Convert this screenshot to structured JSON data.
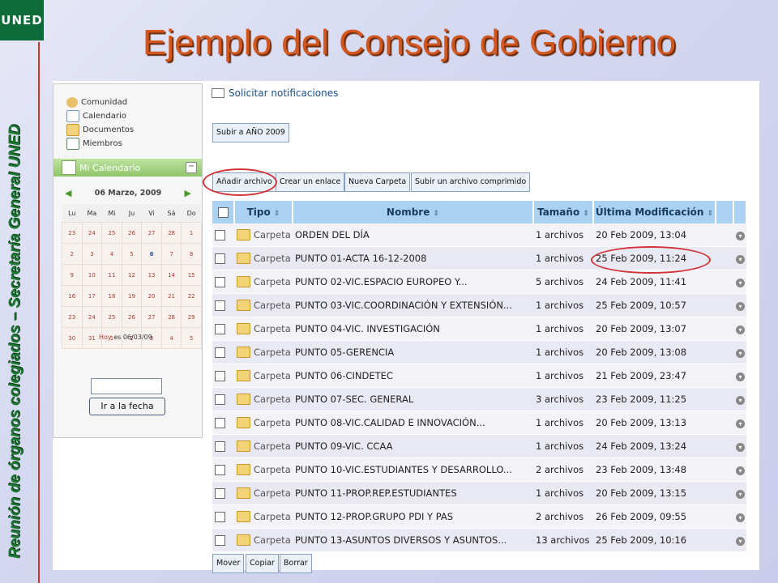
{
  "logo": "UNED",
  "side_caption": "Reunión de órganos colegiados – Secretaría General UNED",
  "title": "Ejemplo del Consejo de Gobierno",
  "sidebar": {
    "links": [
      {
        "label": "Comunidad",
        "icon": "community-icon"
      },
      {
        "label": "Calendario",
        "icon": "calendar-icon"
      },
      {
        "label": "Documentos",
        "icon": "documents-icon"
      },
      {
        "label": "Miembros",
        "icon": "members-icon"
      }
    ],
    "calendar": {
      "header": "Mi Calendario",
      "month": "06 Marzo, 2009",
      "days": [
        "Lu",
        "Ma",
        "Mi",
        "Ju",
        "Vi",
        "Sá",
        "Do"
      ],
      "weeks": [
        [
          "23",
          "24",
          "25",
          "26",
          "27",
          "28",
          "1"
        ],
        [
          "2",
          "3",
          "4",
          "5",
          "6",
          "7",
          "8"
        ],
        [
          "9",
          "10",
          "11",
          "12",
          "13",
          "14",
          "15"
        ],
        [
          "16",
          "17",
          "18",
          "19",
          "20",
          "21",
          "22"
        ],
        [
          "23",
          "24",
          "25",
          "26",
          "27",
          "28",
          "29"
        ],
        [
          "30",
          "31",
          "1",
          "2",
          "3",
          "4",
          "5"
        ]
      ],
      "today_link": "Hoy",
      "today_text": "es 06/03/09",
      "goto_label": "Ir a la fecha"
    }
  },
  "main": {
    "notify": "Solicitar notificaciones",
    "up_button": "Subir a AÑO 2009",
    "actions": [
      "Añadir archivo",
      "Crear un enlace",
      "Nueva Carpeta",
      "Subir un archivo comprimido"
    ],
    "columns": [
      "Tipo",
      "Nombre",
      "Tamaño",
      "Última Modificación"
    ],
    "rows": [
      {
        "tipo": "Carpeta",
        "nombre": "ORDEN DEL DÍA",
        "tamano": "1 archivos",
        "mod": "20 Feb 2009, 13:04"
      },
      {
        "tipo": "Carpeta",
        "nombre": "PUNTO 01-ACTA 16-12-2008",
        "tamano": "1 archivos",
        "mod": "25 Feb 2009, 11:24"
      },
      {
        "tipo": "Carpeta",
        "nombre": "PUNTO 02-VIC.ESPACIO EUROPEO Y...",
        "tamano": "5 archivos",
        "mod": "24 Feb 2009, 11:41"
      },
      {
        "tipo": "Carpeta",
        "nombre": "PUNTO 03-VIC.COORDINACIÓN Y EXTENSIÓN...",
        "tamano": "1 archivos",
        "mod": "25 Feb 2009, 10:57"
      },
      {
        "tipo": "Carpeta",
        "nombre": "PUNTO 04-VIC. INVESTIGACIÓN",
        "tamano": "1 archivos",
        "mod": "20 Feb 2009, 13:07"
      },
      {
        "tipo": "Carpeta",
        "nombre": "PUNTO 05-GERENCIA",
        "tamano": "1 archivos",
        "mod": "20 Feb 2009, 13:08"
      },
      {
        "tipo": "Carpeta",
        "nombre": "PUNTO 06-CINDETEC",
        "tamano": "1 archivos",
        "mod": "21 Feb 2009, 23:47"
      },
      {
        "tipo": "Carpeta",
        "nombre": "PUNTO 07-SEC. GENERAL",
        "tamano": "3 archivos",
        "mod": "23 Feb 2009, 11:25"
      },
      {
        "tipo": "Carpeta",
        "nombre": "PUNTO 08-VIC.CALIDAD E INNOVACIÓN...",
        "tamano": "1 archivos",
        "mod": "20 Feb 2009, 13:13"
      },
      {
        "tipo": "Carpeta",
        "nombre": "PUNTO 09-VIC. CCAA",
        "tamano": "1 archivos",
        "mod": "24 Feb 2009, 13:24"
      },
      {
        "tipo": "Carpeta",
        "nombre": "PUNTO 10-VIC.ESTUDIANTES Y DESARROLLO...",
        "tamano": "2 archivos",
        "mod": "23 Feb 2009, 13:48"
      },
      {
        "tipo": "Carpeta",
        "nombre": "PUNTO 11-PROP.REP.ESTUDIANTES",
        "tamano": "1 archivos",
        "mod": "20 Feb 2009, 13:15"
      },
      {
        "tipo": "Carpeta",
        "nombre": "PUNTO 12-PROP.GRUPO PDI Y PAS",
        "tamano": "2 archivos",
        "mod": "26 Feb 2009, 09:55"
      },
      {
        "tipo": "Carpeta",
        "nombre": "PUNTO 13-ASUNTOS DIVERSOS Y ASUNTOS...",
        "tamano": "13 archivos",
        "mod": "25 Feb 2009, 10:16"
      }
    ],
    "bottom_buttons": [
      "Mover",
      "Copiar",
      "Borrar"
    ]
  },
  "colors": {
    "title": "#d2561e",
    "caption": "#1c7a33",
    "highlight_ring": "#d0343a",
    "header_bg": "#a9d1f0"
  }
}
